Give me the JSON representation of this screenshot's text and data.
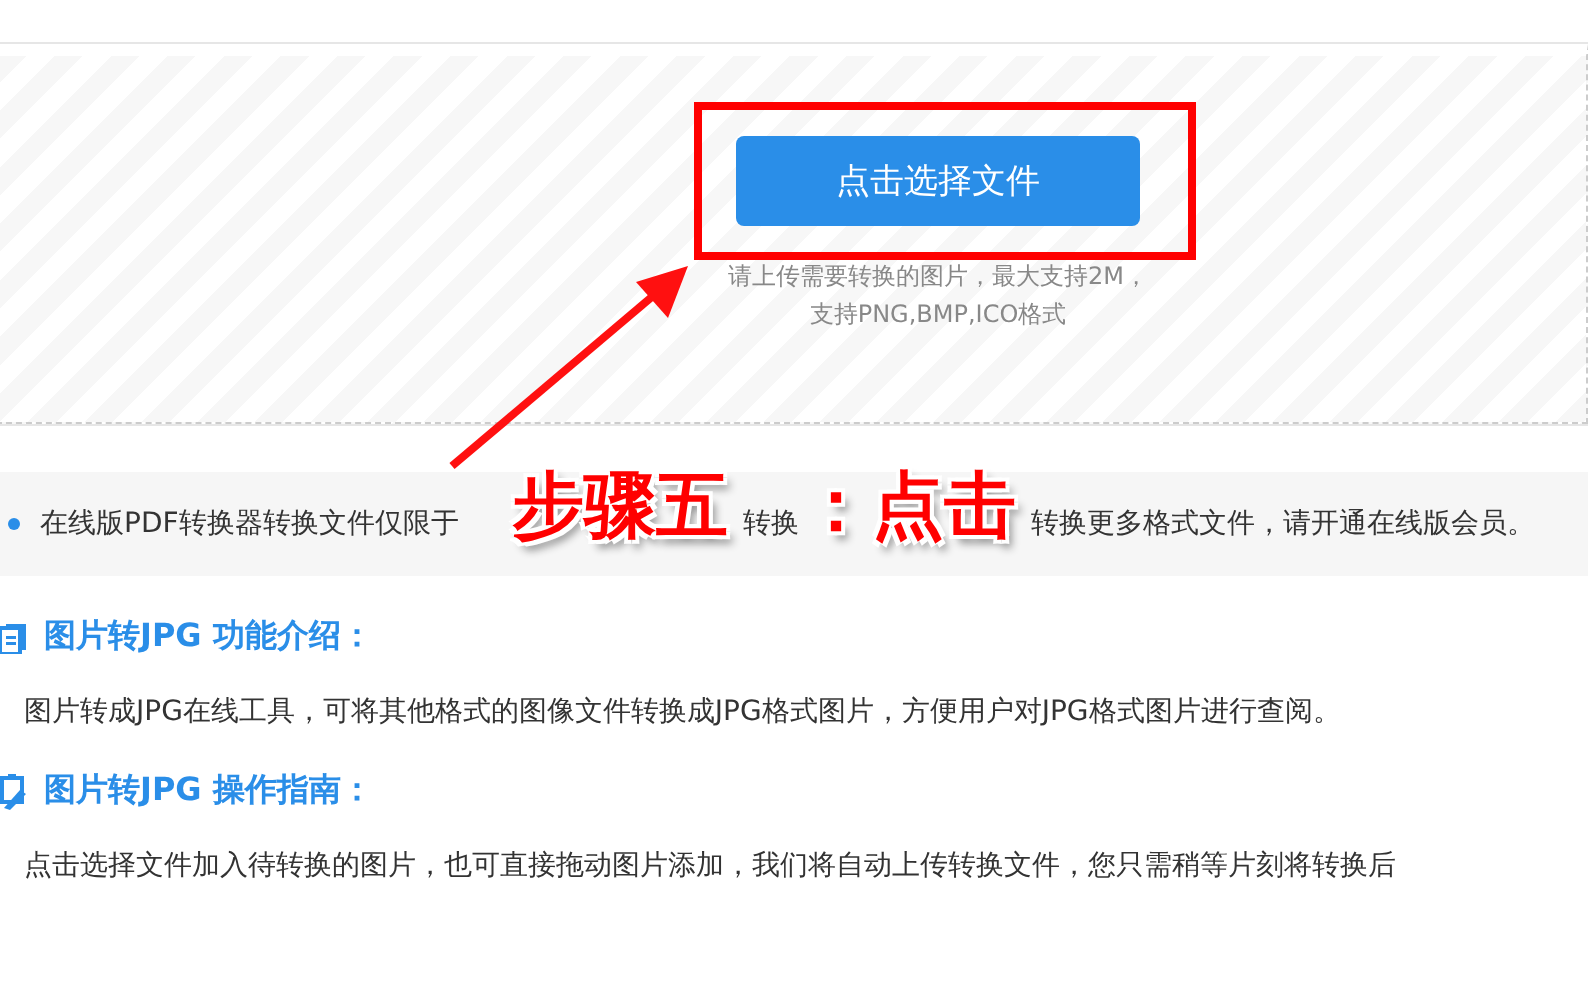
{
  "upload": {
    "button": "点击选择文件",
    "hint_lines": [
      "请上传需要转换的图片，最大支持2M，",
      "支持PNG,BMP,ICO格式"
    ]
  },
  "notice": {
    "segments": [
      "在线版PDF转换器转换文件仅限于",
      "转换",
      "转换更多格式文件，请开通在线版会员。"
    ]
  },
  "sections": [
    {
      "kind": "intro",
      "heading": "图片转JPG 功能介绍：",
      "body": "图片转成JPG在线工具，可将其他格式的图像文件转换成JPG格式图片，方便用户对JPG格式图片进行查阅。"
    },
    {
      "kind": "guide",
      "heading": "图片转JPG 操作指南：",
      "body": "点击选择文件加入待转换的图片，也可直接拖动图片添加，我们将自动上传转换文件，您只需稍等片刻将转换后"
    }
  ],
  "annotation": {
    "parts": [
      "步骤五",
      "：点击"
    ]
  }
}
